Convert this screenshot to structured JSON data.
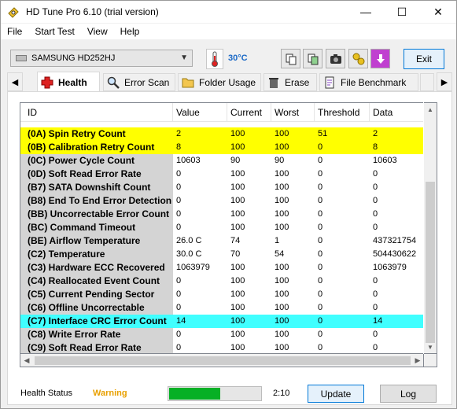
{
  "window": {
    "title": "HD Tune Pro 6.10 (trial version)",
    "minimize": "—",
    "maximize": "☐",
    "close": "✕"
  },
  "menu": [
    "File",
    "Start Test",
    "View",
    "Help"
  ],
  "toolbar": {
    "drive": "SAMSUNG HD252HJ",
    "temperature": "30°C",
    "exit_label": "Exit"
  },
  "tabs": [
    {
      "label": "Health",
      "icon": "health-cross-icon",
      "active": true
    },
    {
      "label": "Error Scan",
      "icon": "magnifier-icon"
    },
    {
      "label": "Folder Usage",
      "icon": "folder-icon"
    },
    {
      "label": "Erase",
      "icon": "trash-icon"
    },
    {
      "label": "File Benchmark",
      "icon": "document-icon"
    }
  ],
  "table": {
    "columns": [
      "ID",
      "Value",
      "Current",
      "Worst",
      "Threshold",
      "Data"
    ],
    "rows": [
      {
        "id": "(0A) Spin Retry Count",
        "value": "2",
        "current": "100",
        "worst": "100",
        "threshold": "51",
        "data": "2",
        "hl": "y"
      },
      {
        "id": "(0B) Calibration Retry Count",
        "value": "8",
        "current": "100",
        "worst": "100",
        "threshold": "0",
        "data": "8",
        "hl": "y"
      },
      {
        "id": "(0C) Power Cycle Count",
        "value": "10603",
        "current": "90",
        "worst": "90",
        "threshold": "0",
        "data": "10603",
        "hl": ""
      },
      {
        "id": "(0D) Soft Read Error Rate",
        "value": "0",
        "current": "100",
        "worst": "100",
        "threshold": "0",
        "data": "0",
        "hl": ""
      },
      {
        "id": "(B7) SATA Downshift Count",
        "value": "0",
        "current": "100",
        "worst": "100",
        "threshold": "0",
        "data": "0",
        "hl": ""
      },
      {
        "id": "(B8) End To End Error Detection",
        "value": "0",
        "current": "100",
        "worst": "100",
        "threshold": "0",
        "data": "0",
        "hl": ""
      },
      {
        "id": "(BB) Uncorrectable Error Count",
        "value": "0",
        "current": "100",
        "worst": "100",
        "threshold": "0",
        "data": "0",
        "hl": ""
      },
      {
        "id": "(BC) Command Timeout",
        "value": "0",
        "current": "100",
        "worst": "100",
        "threshold": "0",
        "data": "0",
        "hl": ""
      },
      {
        "id": "(BE) Airflow Temperature",
        "value": "26.0 C",
        "current": "74",
        "worst": "1",
        "threshold": "0",
        "data": "437321754",
        "hl": ""
      },
      {
        "id": "(C2) Temperature",
        "value": "30.0 C",
        "current": "70",
        "worst": "54",
        "threshold": "0",
        "data": "504430622",
        "hl": ""
      },
      {
        "id": "(C3) Hardware ECC Recovered",
        "value": "1063979",
        "current": "100",
        "worst": "100",
        "threshold": "0",
        "data": "1063979",
        "hl": ""
      },
      {
        "id": "(C4) Reallocated Event Count",
        "value": "0",
        "current": "100",
        "worst": "100",
        "threshold": "0",
        "data": "0",
        "hl": ""
      },
      {
        "id": "(C5) Current Pending Sector",
        "value": "0",
        "current": "100",
        "worst": "100",
        "threshold": "0",
        "data": "0",
        "hl": ""
      },
      {
        "id": "(C6) Offline Uncorrectable",
        "value": "0",
        "current": "100",
        "worst": "100",
        "threshold": "0",
        "data": "0",
        "hl": ""
      },
      {
        "id": "(C7) Interface CRC Error Count",
        "value": "14",
        "current": "100",
        "worst": "100",
        "threshold": "0",
        "data": "14",
        "hl": "c"
      },
      {
        "id": "(C8) Write Error Rate",
        "value": "0",
        "current": "100",
        "worst": "100",
        "threshold": "0",
        "data": "0",
        "hl": ""
      },
      {
        "id": "(C9) Soft Read Error Rate",
        "value": "0",
        "current": "100",
        "worst": "100",
        "threshold": "0",
        "data": "0",
        "hl": ""
      }
    ]
  },
  "status": {
    "label": "Health Status",
    "value": "Warning",
    "progress_fraction": 0.55,
    "time": "2:10",
    "update_label": "Update",
    "log_label": "Log"
  },
  "colors": {
    "warning_row": "#ffff00",
    "crc_row": "#40ffff",
    "warning_text": "#e8a000",
    "temp_text": "#1b69c6",
    "progress": "#06b025"
  }
}
